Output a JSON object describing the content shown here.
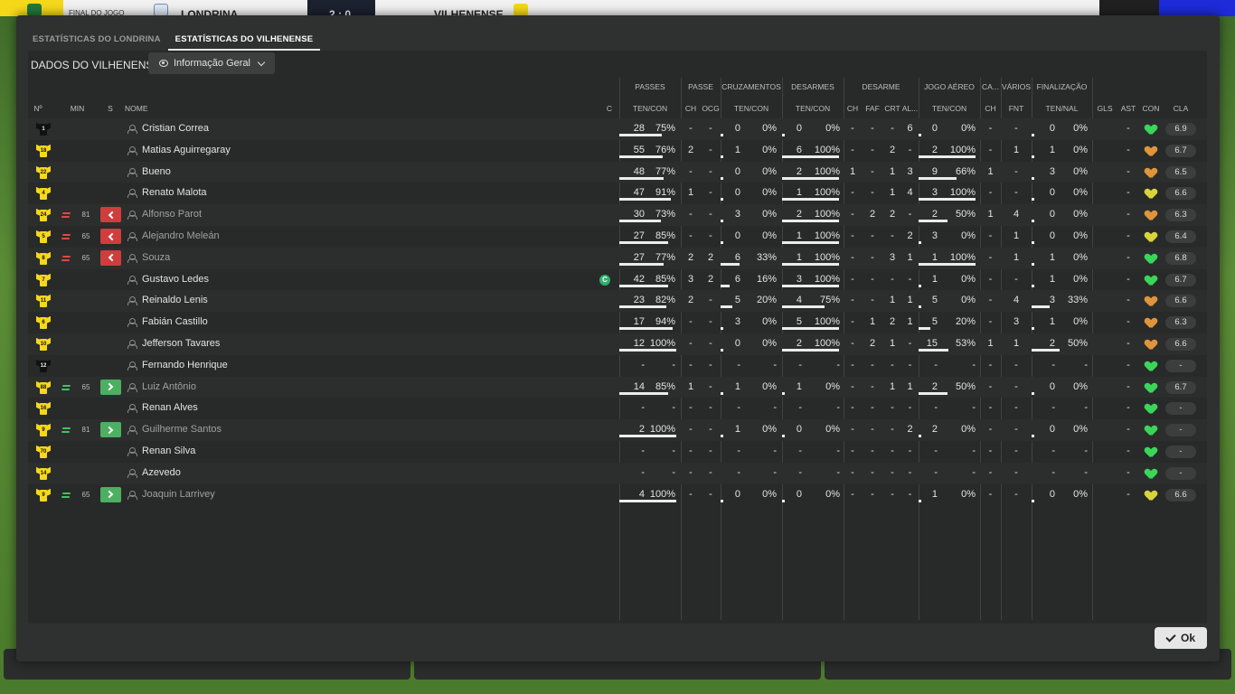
{
  "scoreboard": {
    "status": "FINAL DO JOGO",
    "home_team": "LONDRINA",
    "score": "2 : 0",
    "away_team": "VILHENENSE"
  },
  "tabs": [
    {
      "label": "ESTATÍSTICAS DO LONDRINA",
      "active": false
    },
    {
      "label": "ESTATÍSTICAS DO VILHENENSE",
      "active": true
    }
  ],
  "panel": {
    "title": "DADOS DO VILHENENSE",
    "view_label": "Informação Geral"
  },
  "groups": {
    "passes": "PASSES",
    "passe": "PASSE",
    "cruzamentos": "CRUZAMENTOS",
    "desarmes": "DESARMES",
    "desarme": "DESARME",
    "jogo_aereo": "JOGO AÉREO",
    "cartoes": "CA...",
    "varios": "VÁRIOS",
    "finalizacao": "FINALIZAÇÃO"
  },
  "columns": {
    "num": "Nº",
    "min": "MIN",
    "s": "S",
    "nome": "NOME",
    "c": "C",
    "passes_tc": "TEN/CON",
    "passe_ch": "CH",
    "passe_ocg": "OCG",
    "cruz_tc": "TEN/CON",
    "des_tc": "TEN/CON",
    "d_ch": "CH",
    "d_faf": "FAF",
    "d_crt": "CRT",
    "d_al": "AL...",
    "aer_tc": "TEN/CON",
    "ca_ch": "CH",
    "var_fnt": "FNT",
    "fin_tn": "TEN/NAL",
    "gls": "GLS",
    "ast": "AST",
    "con": "CON",
    "cla": "CLA"
  },
  "colors": {
    "shirt_yellow": "#f6d81a",
    "shirt_black": "#111111",
    "heart_green": "#39d65a",
    "heart_orange": "#e0953a",
    "heart_yellow": "#d9d43a",
    "sub_out": "#cf3d3d",
    "sub_in": "#4caf62"
  },
  "players": [
    {
      "num": "1",
      "shirt": "black",
      "min": "",
      "sub": "",
      "name": "Cristian Correa",
      "cap": "",
      "pass_t": "28",
      "pass_c": "75%",
      "pass_pct": 75,
      "p_ch": "-",
      "p_ocg": "-",
      "cr_t": "0",
      "cr_c": "0%",
      "cr_pct": 0,
      "de_t": "0",
      "de_c": "0%",
      "de_pct": 0,
      "d_ch": "-",
      "d_faf": "-",
      "d_crt": "-",
      "d_al": "6",
      "ae_t": "0",
      "ae_c": "0%",
      "ae_pct": 0,
      "ca_ch": "-",
      "fnt": "-",
      "fi_t": "0",
      "fi_c": "0%",
      "fi_pct": 0,
      "gls": "",
      "ast": "-",
      "heart": "green",
      "cla": "6.9"
    },
    {
      "num": "18",
      "shirt": "yellow",
      "min": "",
      "sub": "",
      "name": "Matias Aguirregaray",
      "cap": "",
      "pass_t": "55",
      "pass_c": "76%",
      "pass_pct": 76,
      "p_ch": "2",
      "p_ocg": "-",
      "cr_t": "1",
      "cr_c": "0%",
      "cr_pct": 0,
      "de_t": "6",
      "de_c": "100%",
      "de_pct": 100,
      "d_ch": "-",
      "d_faf": "-",
      "d_crt": "2",
      "d_al": "-",
      "ae_t": "2",
      "ae_c": "100%",
      "ae_pct": 100,
      "ca_ch": "-",
      "fnt": "1",
      "fi_t": "1",
      "fi_c": "0%",
      "fi_pct": 0,
      "gls": "",
      "ast": "-",
      "heart": "orange",
      "cla": "6.7"
    },
    {
      "num": "22",
      "shirt": "yellow",
      "min": "",
      "sub": "",
      "name": "Bueno",
      "cap": "",
      "pass_t": "48",
      "pass_c": "77%",
      "pass_pct": 77,
      "p_ch": "-",
      "p_ocg": "-",
      "cr_t": "0",
      "cr_c": "0%",
      "cr_pct": 0,
      "de_t": "2",
      "de_c": "100%",
      "de_pct": 100,
      "d_ch": "1",
      "d_faf": "-",
      "d_crt": "1",
      "d_al": "3",
      "ae_t": "9",
      "ae_c": "66%",
      "ae_pct": 66,
      "ca_ch": "1",
      "fnt": "-",
      "fi_t": "3",
      "fi_c": "0%",
      "fi_pct": 0,
      "gls": "",
      "ast": "-",
      "heart": "orange",
      "cla": "6.5"
    },
    {
      "num": "4",
      "shirt": "yellow",
      "min": "",
      "sub": "",
      "name": "Renato Malota",
      "cap": "",
      "pass_t": "47",
      "pass_c": "91%",
      "pass_pct": 91,
      "p_ch": "1",
      "p_ocg": "-",
      "cr_t": "0",
      "cr_c": "0%",
      "cr_pct": 0,
      "de_t": "1",
      "de_c": "100%",
      "de_pct": 100,
      "d_ch": "-",
      "d_faf": "-",
      "d_crt": "1",
      "d_al": "4",
      "ae_t": "3",
      "ae_c": "100%",
      "ae_pct": 100,
      "ca_ch": "-",
      "fnt": "-",
      "fi_t": "0",
      "fi_c": "0%",
      "fi_pct": 0,
      "gls": "",
      "ast": "-",
      "heart": "yellow",
      "cla": "6.6"
    },
    {
      "num": "24",
      "shirt": "yellow",
      "min": "81",
      "sub": "out",
      "name": "Alfonso Parot",
      "cap": "",
      "pass_t": "30",
      "pass_c": "73%",
      "pass_pct": 73,
      "p_ch": "-",
      "p_ocg": "-",
      "cr_t": "3",
      "cr_c": "0%",
      "cr_pct": 0,
      "de_t": "2",
      "de_c": "100%",
      "de_pct": 100,
      "d_ch": "-",
      "d_faf": "2",
      "d_crt": "2",
      "d_al": "-",
      "ae_t": "2",
      "ae_c": "50%",
      "ae_pct": 50,
      "ca_ch": "1",
      "fnt": "4",
      "fi_t": "0",
      "fi_c": "0%",
      "fi_pct": 0,
      "gls": "",
      "ast": "-",
      "heart": "orange",
      "cla": "6.3"
    },
    {
      "num": "5",
      "shirt": "yellow",
      "min": "65",
      "sub": "out",
      "name": "Alejandro Meleán",
      "cap": "",
      "pass_t": "27",
      "pass_c": "85%",
      "pass_pct": 85,
      "p_ch": "-",
      "p_ocg": "-",
      "cr_t": "0",
      "cr_c": "0%",
      "cr_pct": 0,
      "de_t": "1",
      "de_c": "100%",
      "de_pct": 100,
      "d_ch": "-",
      "d_faf": "-",
      "d_crt": "-",
      "d_al": "2",
      "ae_t": "3",
      "ae_c": "0%",
      "ae_pct": 0,
      "ca_ch": "-",
      "fnt": "1",
      "fi_t": "0",
      "fi_c": "0%",
      "fi_pct": 0,
      "gls": "",
      "ast": "-",
      "heart": "yellow",
      "cla": "6.4"
    },
    {
      "num": "8",
      "shirt": "yellow",
      "min": "65",
      "sub": "out",
      "name": "Souza",
      "cap": "",
      "pass_t": "27",
      "pass_c": "77%",
      "pass_pct": 77,
      "p_ch": "2",
      "p_ocg": "2",
      "cr_t": "6",
      "cr_c": "33%",
      "cr_pct": 33,
      "de_t": "1",
      "de_c": "100%",
      "de_pct": 100,
      "d_ch": "-",
      "d_faf": "-",
      "d_crt": "3",
      "d_al": "1",
      "ae_t": "1",
      "ae_c": "100%",
      "ae_pct": 100,
      "ca_ch": "-",
      "fnt": "1",
      "fi_t": "1",
      "fi_c": "0%",
      "fi_pct": 0,
      "gls": "",
      "ast": "-",
      "heart": "green",
      "cla": "6.8"
    },
    {
      "num": "7",
      "shirt": "yellow",
      "min": "",
      "sub": "",
      "name": "Gustavo Ledes",
      "cap": "C",
      "pass_t": "42",
      "pass_c": "85%",
      "pass_pct": 85,
      "p_ch": "3",
      "p_ocg": "2",
      "cr_t": "6",
      "cr_c": "16%",
      "cr_pct": 16,
      "de_t": "3",
      "de_c": "100%",
      "de_pct": 100,
      "d_ch": "-",
      "d_faf": "-",
      "d_crt": "-",
      "d_al": "-",
      "ae_t": "1",
      "ae_c": "0%",
      "ae_pct": 0,
      "ca_ch": "-",
      "fnt": "-",
      "fi_t": "1",
      "fi_c": "0%",
      "fi_pct": 0,
      "gls": "",
      "ast": "-",
      "heart": "green",
      "cla": "6.7"
    },
    {
      "num": "11",
      "shirt": "yellow",
      "min": "",
      "sub": "",
      "name": "Reinaldo Lenis",
      "cap": "",
      "pass_t": "23",
      "pass_c": "82%",
      "pass_pct": 82,
      "p_ch": "2",
      "p_ocg": "-",
      "cr_t": "5",
      "cr_c": "20%",
      "cr_pct": 20,
      "de_t": "4",
      "de_c": "75%",
      "de_pct": 75,
      "d_ch": "-",
      "d_faf": "-",
      "d_crt": "1",
      "d_al": "1",
      "ae_t": "5",
      "ae_c": "0%",
      "ae_pct": 0,
      "ca_ch": "-",
      "fnt": "4",
      "fi_t": "3",
      "fi_c": "33%",
      "fi_pct": 33,
      "gls": "",
      "ast": "-",
      "heart": "orange",
      "cla": "6.6"
    },
    {
      "num": "6",
      "shirt": "yellow",
      "min": "",
      "sub": "",
      "name": "Fabián Castillo",
      "cap": "",
      "pass_t": "17",
      "pass_c": "94%",
      "pass_pct": 94,
      "p_ch": "-",
      "p_ocg": "-",
      "cr_t": "3",
      "cr_c": "0%",
      "cr_pct": 0,
      "de_t": "5",
      "de_c": "100%",
      "de_pct": 100,
      "d_ch": "-",
      "d_faf": "1",
      "d_crt": "2",
      "d_al": "1",
      "ae_t": "5",
      "ae_c": "20%",
      "ae_pct": 20,
      "ca_ch": "-",
      "fnt": "3",
      "fi_t": "1",
      "fi_c": "0%",
      "fi_pct": 0,
      "gls": "",
      "ast": "-",
      "heart": "orange",
      "cla": "6.3"
    },
    {
      "num": "10",
      "shirt": "yellow",
      "min": "",
      "sub": "",
      "name": "Jefferson Tavares",
      "cap": "",
      "pass_t": "12",
      "pass_c": "100%",
      "pass_pct": 100,
      "p_ch": "-",
      "p_ocg": "-",
      "cr_t": "0",
      "cr_c": "0%",
      "cr_pct": 0,
      "de_t": "2",
      "de_c": "100%",
      "de_pct": 100,
      "d_ch": "-",
      "d_faf": "2",
      "d_crt": "1",
      "d_al": "-",
      "ae_t": "15",
      "ae_c": "53%",
      "ae_pct": 53,
      "ca_ch": "1",
      "fnt": "1",
      "fi_t": "2",
      "fi_c": "50%",
      "fi_pct": 50,
      "gls": "",
      "ast": "-",
      "heart": "orange",
      "cla": "6.6"
    },
    {
      "num": "12",
      "shirt": "black",
      "min": "",
      "sub": "",
      "name": "Fernando Henrique",
      "cap": "",
      "pass_t": "-",
      "pass_c": "-",
      "pass_pct": null,
      "p_ch": "-",
      "p_ocg": "-",
      "cr_t": "-",
      "cr_c": "-",
      "cr_pct": null,
      "de_t": "-",
      "de_c": "-",
      "de_pct": null,
      "d_ch": "-",
      "d_faf": "-",
      "d_crt": "-",
      "d_al": "-",
      "ae_t": "-",
      "ae_c": "-",
      "ae_pct": null,
      "ca_ch": "-",
      "fnt": "-",
      "fi_t": "-",
      "fi_c": "-",
      "fi_pct": null,
      "gls": "",
      "ast": "-",
      "heart": "green",
      "cla": "-"
    },
    {
      "num": "88",
      "shirt": "yellow",
      "min": "65",
      "sub": "in",
      "name": "Luiz Antônio",
      "cap": "",
      "pass_t": "14",
      "pass_c": "85%",
      "pass_pct": 85,
      "p_ch": "1",
      "p_ocg": "-",
      "cr_t": "1",
      "cr_c": "0%",
      "cr_pct": 0,
      "de_t": "1",
      "de_c": "0%",
      "de_pct": 0,
      "d_ch": "-",
      "d_faf": "-",
      "d_crt": "1",
      "d_al": "1",
      "ae_t": "2",
      "ae_c": "50%",
      "ae_pct": 50,
      "ca_ch": "-",
      "fnt": "-",
      "fi_t": "0",
      "fi_c": "0%",
      "fi_pct": 0,
      "gls": "",
      "ast": "-",
      "heart": "green",
      "cla": "6.7"
    },
    {
      "num": "16",
      "shirt": "yellow",
      "min": "",
      "sub": "",
      "name": "Renan Alves",
      "cap": "",
      "pass_t": "-",
      "pass_c": "-",
      "pass_pct": null,
      "p_ch": "-",
      "p_ocg": "-",
      "cr_t": "-",
      "cr_c": "-",
      "cr_pct": null,
      "de_t": "-",
      "de_c": "-",
      "de_pct": null,
      "d_ch": "-",
      "d_faf": "-",
      "d_crt": "-",
      "d_al": "-",
      "ae_t": "-",
      "ae_c": "-",
      "ae_pct": null,
      "ca_ch": "-",
      "fnt": "-",
      "fi_t": "-",
      "fi_c": "-",
      "fi_pct": null,
      "gls": "",
      "ast": "-",
      "heart": "green",
      "cla": "-"
    },
    {
      "num": "9",
      "shirt": "yellow",
      "min": "81",
      "sub": "in",
      "name": "Guilherme Santos",
      "cap": "",
      "pass_t": "2",
      "pass_c": "100%",
      "pass_pct": 100,
      "p_ch": "-",
      "p_ocg": "-",
      "cr_t": "1",
      "cr_c": "0%",
      "cr_pct": 0,
      "de_t": "0",
      "de_c": "0%",
      "de_pct": 0,
      "d_ch": "-",
      "d_faf": "-",
      "d_crt": "-",
      "d_al": "2",
      "ae_t": "2",
      "ae_c": "0%",
      "ae_pct": 0,
      "ca_ch": "-",
      "fnt": "-",
      "fi_t": "0",
      "fi_c": "0%",
      "fi_pct": 0,
      "gls": "",
      "ast": "-",
      "heart": "green",
      "cla": "-"
    },
    {
      "num": "70",
      "shirt": "yellow",
      "min": "",
      "sub": "",
      "name": "Renan Silva",
      "cap": "",
      "pass_t": "-",
      "pass_c": "-",
      "pass_pct": null,
      "p_ch": "-",
      "p_ocg": "-",
      "cr_t": "-",
      "cr_c": "-",
      "cr_pct": null,
      "de_t": "-",
      "de_c": "-",
      "de_pct": null,
      "d_ch": "-",
      "d_faf": "-",
      "d_crt": "-",
      "d_al": "-",
      "ae_t": "-",
      "ae_c": "-",
      "ae_pct": null,
      "ca_ch": "-",
      "fnt": "-",
      "fi_t": "-",
      "fi_c": "-",
      "fi_pct": null,
      "gls": "",
      "ast": "-",
      "heart": "green",
      "cla": "-"
    },
    {
      "num": "14",
      "shirt": "yellow",
      "min": "",
      "sub": "",
      "name": "Azevedo",
      "cap": "",
      "pass_t": "-",
      "pass_c": "-",
      "pass_pct": null,
      "p_ch": "-",
      "p_ocg": "-",
      "cr_t": "-",
      "cr_c": "-",
      "cr_pct": null,
      "de_t": "-",
      "de_c": "-",
      "de_pct": null,
      "d_ch": "-",
      "d_faf": "-",
      "d_crt": "-",
      "d_al": "-",
      "ae_t": "-",
      "ae_c": "-",
      "ae_pct": null,
      "ca_ch": "-",
      "fnt": "-",
      "fi_t": "-",
      "fi_c": "-",
      "fi_pct": null,
      "gls": "",
      "ast": "-",
      "heart": "green",
      "cla": "-"
    },
    {
      "num": "9",
      "shirt": "yellow",
      "min": "65",
      "sub": "in",
      "name": "Joaquin Larrivey",
      "cap": "",
      "pass_t": "4",
      "pass_c": "100%",
      "pass_pct": 100,
      "p_ch": "-",
      "p_ocg": "-",
      "cr_t": "0",
      "cr_c": "0%",
      "cr_pct": 0,
      "de_t": "0",
      "de_c": "0%",
      "de_pct": 0,
      "d_ch": "-",
      "d_faf": "-",
      "d_crt": "-",
      "d_al": "-",
      "ae_t": "1",
      "ae_c": "0%",
      "ae_pct": 0,
      "ca_ch": "-",
      "fnt": "-",
      "fi_t": "0",
      "fi_c": "0%",
      "fi_pct": 0,
      "gls": "",
      "ast": "-",
      "heart": "yellow",
      "cla": "6.6"
    }
  ],
  "ok_label": "Ok"
}
